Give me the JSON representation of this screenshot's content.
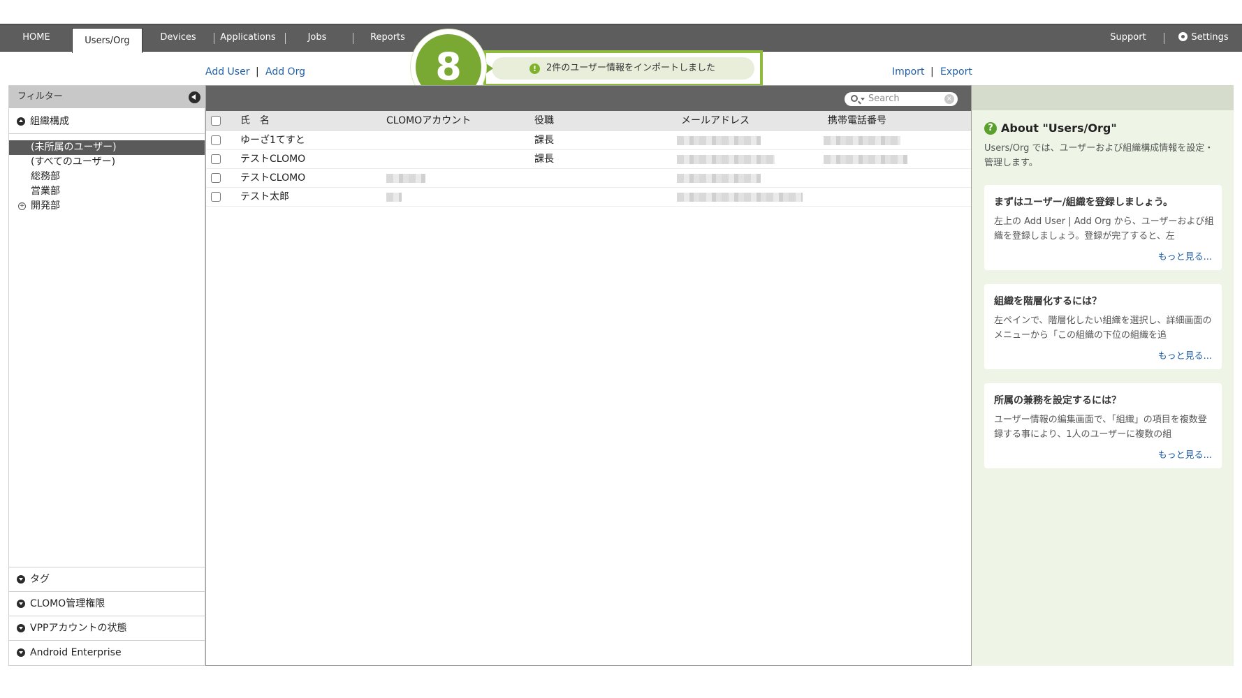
{
  "nav": {
    "home": "HOME",
    "users_org": "Users/Org",
    "devices": "Devices",
    "applications": "Applications",
    "jobs": "Jobs",
    "reports": "Reports",
    "support": "Support",
    "settings": "Settings"
  },
  "actions": {
    "add_user": "Add User",
    "add_org": "Add Org",
    "import": "Import",
    "export": "Export",
    "separator": "|"
  },
  "step": {
    "number": "8"
  },
  "toast": {
    "icon": "!",
    "message": "2件のユーザー情報をインポートしました"
  },
  "filter": {
    "header": "フィルター",
    "org_section": "組織構成",
    "org_items": [
      "(未所属のユーザー)",
      "(すべてのユーザー)",
      "総務部",
      "営業部",
      "開発部"
    ],
    "expand_symbol": "+",
    "tag_section": "タグ",
    "admin_section": "CLOMO管理権限",
    "vpp_section": "VPPアカウントの状態",
    "android_section": "Android Enterprise"
  },
  "table": {
    "search_placeholder": "Search",
    "clear_symbol": "×",
    "columns": [
      "氏　名",
      "CLOMOアカウント",
      "役職",
      "メールアドレス",
      "携帯電話番号"
    ],
    "rows": [
      {
        "name": "ゆーざ1てすと",
        "title": "課長"
      },
      {
        "name": "テストCLOMO",
        "title": "課長"
      },
      {
        "name": "テストCLOMO",
        "title": ""
      },
      {
        "name": "テスト太郎",
        "title": ""
      }
    ]
  },
  "help": {
    "icon": "?",
    "title": "About \"Users/Org\"",
    "description": "Users/Org では、ユーザーおよび組織構成情報を設定・管理します。",
    "cards": [
      {
        "title": "まずはユーザー/組織を登録しましょう。",
        "body": "左上の Add User | Add Org から、ユーザーおよび組織を登録しましょう。登録が完了すると、左",
        "more": "もっと見る..."
      },
      {
        "title": "組織を階層化するには？",
        "body": "左ペインで、階層化したい組織を選択し、詳細画面のメニューから「この組織の下位の組織を追",
        "more": "もっと見る..."
      },
      {
        "title": "所属の兼務を設定するには？",
        "body": "ユーザー情報の編集画面で、「組織」の項目を複数登録する事により、1人のユーザーに複数の組",
        "more": "もっと見る..."
      }
    ]
  },
  "colors": {
    "nav_bg": "#5d5d5d",
    "accent_green": "#79a833",
    "link_blue": "#1f5fa8",
    "help_bg": "#eef5e6"
  }
}
